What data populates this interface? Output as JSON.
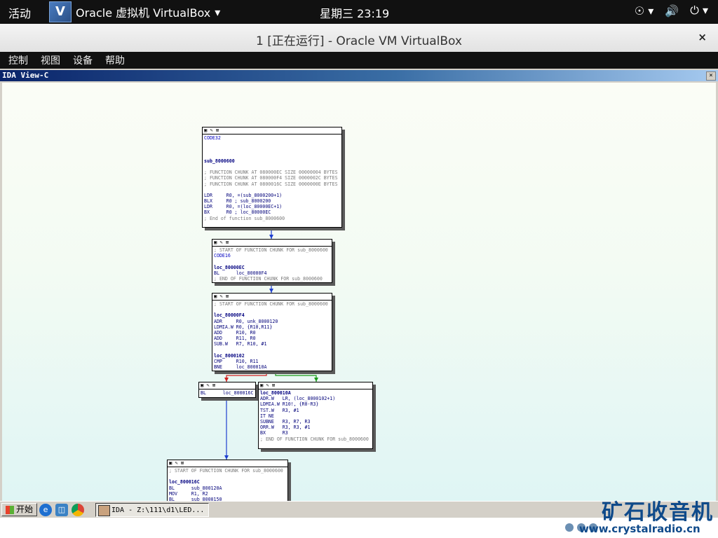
{
  "topbar": {
    "activities": "活动",
    "app_menu_label": "Oracle 虚拟机 VirtualBox",
    "app_menu_arrow": "▾",
    "clock": "星期三 23:19",
    "accessibility_icon": "☉",
    "volume_icon": "🔊",
    "power_icon": "⏻",
    "arrow": "▾"
  },
  "window": {
    "title": "1 [正在运行] - Oracle VM VirtualBox",
    "close": "×"
  },
  "menubar": [
    "控制",
    "视图",
    "设备",
    "帮助"
  ],
  "ida": {
    "title": "IDA View-C",
    "close": "×",
    "blocks": [
      {
        "lines": [
          {
            "t": "CODE32",
            "k": "d"
          },
          {
            "t": "",
            "k": ""
          },
          {
            "t": "",
            "k": ""
          },
          {
            "t": "",
            "k": ""
          },
          {
            "t": "sub_8000600",
            "k": "l"
          },
          {
            "t": "",
            "k": ""
          },
          {
            "t": "; FUNCTION CHUNK AT 080000EC SIZE 00000004 BYTES",
            "k": "c"
          },
          {
            "t": "; FUNCTION CHUNK AT 080000F4 SIZE 0000002C BYTES",
            "k": "c"
          },
          {
            "t": "; FUNCTION CHUNK AT 0800016C SIZE 0000000E BYTES",
            "k": "c"
          },
          {
            "t": "",
            "k": ""
          },
          {
            "t": "LDR     R0, =(sub_8000200+1)",
            "k": ""
          },
          {
            "t": "BLX     R0 ; sub_8000200",
            "k": ""
          },
          {
            "t": "LDR     R0, =(loc_80000EC+1)",
            "k": ""
          },
          {
            "t": "BX      R0 ; loc_80000EC",
            "k": ""
          },
          {
            "t": "; End of function sub_8000600",
            "k": "c"
          }
        ]
      },
      {
        "lines": [
          {
            "t": "; START OF FUNCTION CHUNK FOR sub_8000600",
            "k": "c"
          },
          {
            "t": "CODE16",
            "k": "d"
          },
          {
            "t": "",
            "k": ""
          },
          {
            "t": "loc_80000EC",
            "k": "l"
          },
          {
            "t": "BL      loc_80000F4",
            "k": ""
          },
          {
            "t": "; END OF FUNCTION CHUNK FOR sub_8000600",
            "k": "c"
          }
        ]
      },
      {
        "lines": [
          {
            "t": "; START OF FUNCTION CHUNK FOR sub_8000600",
            "k": "c"
          },
          {
            "t": "",
            "k": ""
          },
          {
            "t": "loc_80000F4",
            "k": "l"
          },
          {
            "t": "ADR     R0, unk_8000120",
            "k": ""
          },
          {
            "t": "LDMIA.W R0, {R10,R11}",
            "k": ""
          },
          {
            "t": "ADD     R10, R0",
            "k": ""
          },
          {
            "t": "ADD     R11, R0",
            "k": ""
          },
          {
            "t": "SUB.W   R7, R10, #1",
            "k": ""
          },
          {
            "t": "",
            "k": ""
          },
          {
            "t": "loc_8000102",
            "k": "l"
          },
          {
            "t": "CMP     R10, R11",
            "k": ""
          },
          {
            "t": "BNE     loc_800010A",
            "k": ""
          }
        ]
      },
      {
        "lines": [
          {
            "t": "BL      loc_800016C",
            "k": ""
          }
        ]
      },
      {
        "lines": [
          {
            "t": "loc_800010A",
            "k": "l"
          },
          {
            "t": "ADR.W   LR, (loc_8000102+1)",
            "k": ""
          },
          {
            "t": "LDMIA.W R10!, {R0-R3}",
            "k": ""
          },
          {
            "t": "TST.W   R3, #1",
            "k": ""
          },
          {
            "t": "IT NE",
            "k": ""
          },
          {
            "t": "SUBNE   R3, R7, R3",
            "k": ""
          },
          {
            "t": "ORR.W   R3, R3, #1",
            "k": ""
          },
          {
            "t": "BX      R3",
            "k": ""
          },
          {
            "t": "; END OF FUNCTION CHUNK FOR sub_8000600",
            "k": "c"
          }
        ]
      },
      {
        "lines": [
          {
            "t": "; START OF FUNCTION CHUNK FOR sub_8000600",
            "k": "c"
          },
          {
            "t": "",
            "k": ""
          },
          {
            "t": "loc_800016C",
            "k": "l"
          },
          {
            "t": "BL      sub_800120A",
            "k": ""
          },
          {
            "t": "MOV     R1, R2",
            "k": ""
          },
          {
            "t": "BL      sub_8000150",
            "k": ""
          }
        ]
      }
    ]
  },
  "taskbar": {
    "start_label": "开始",
    "task_label": "IDA - Z:\\111\\d1\\LED..."
  },
  "watermark": {
    "text": "矿石收音机",
    "url": "www.crystalradio.cn"
  },
  "colors": {
    "edge_normal": "#1e3fd0",
    "edge_false": "#d02020",
    "edge_true": "#1a9a1a"
  }
}
